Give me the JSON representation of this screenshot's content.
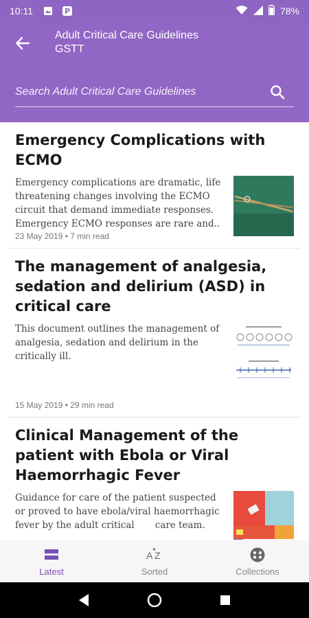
{
  "status_bar": {
    "time": "10:11",
    "battery": "78%",
    "icons": [
      "image-icon",
      "parking-icon",
      "wifi-icon",
      "signal-icon",
      "battery-icon"
    ]
  },
  "header": {
    "title": "Adult Critical Care Guidelines",
    "subtitle": "GSTT",
    "search_placeholder": "Search Adult Critical Care Guidelines",
    "background": "#9266c5"
  },
  "articles": [
    {
      "title": "Emergency Complications with ECMO",
      "summary": "Emergency complications are dramatic, life threatening changes involving the ECMO circuit that demand immediate responses. Emergency ECMO responses are rare and..",
      "meta": "23 May 2019 • 7 min read"
    },
    {
      "title": "The management of analgesia, sedation and delirium (ASD) in critical care",
      "summary": "This document outlines the management of analgesia, sedation and delirium in the critically ill.",
      "meta": "15 May 2019 • 29 min read"
    },
    {
      "title": "Clinical Management of the patient with Ebola or Viral Haemorrhagic Fever",
      "summary": "Guidance for care of the patient suspected or proved to have ebola/viral haemorrhagic fever by the adult critical       care team.",
      "meta": ""
    }
  ],
  "bottom_nav": {
    "items": [
      {
        "label": "Latest",
        "icon": "latest-icon",
        "active": true
      },
      {
        "label": "Sorted",
        "icon": "sort-az-icon",
        "active": false
      },
      {
        "label": "Collections",
        "icon": "collections-icon",
        "active": false
      }
    ],
    "accent": "#7a4fb5"
  }
}
